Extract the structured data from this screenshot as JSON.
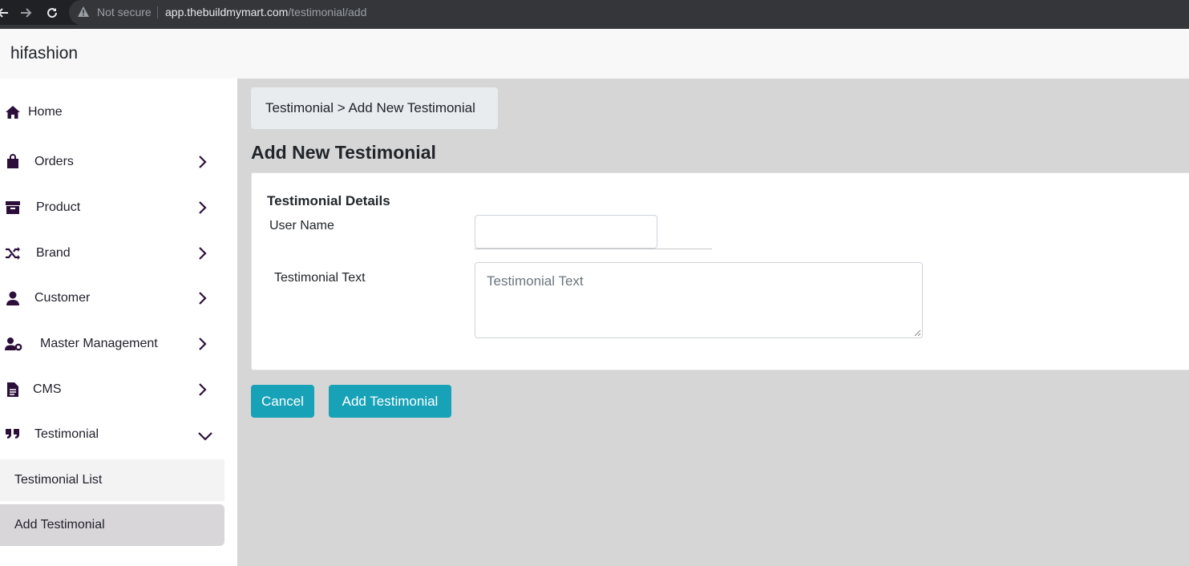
{
  "browser": {
    "security_label": "Not secure",
    "url_host": "app.thebuildmymart.com",
    "url_path": "/testimonial/add"
  },
  "header": {
    "brand": "hifashion"
  },
  "sidebar": {
    "items": [
      {
        "label": "Home",
        "icon": "home-icon",
        "has_chevron": false
      },
      {
        "label": "Orders",
        "icon": "shopping-bag-icon",
        "has_chevron": true
      },
      {
        "label": "Product",
        "icon": "archive-box-icon",
        "has_chevron": true
      },
      {
        "label": "Brand",
        "icon": "shuffle-icon",
        "has_chevron": true
      },
      {
        "label": "Customer",
        "icon": "user-icon",
        "has_chevron": true
      },
      {
        "label": "Master Management",
        "icon": "user-cog-icon",
        "has_chevron": true
      },
      {
        "label": "CMS",
        "icon": "document-icon",
        "has_chevron": true
      },
      {
        "label": "Testimonial",
        "icon": "quote-icon",
        "expanded": true
      }
    ],
    "subitems": [
      {
        "label": "Testimonial List",
        "active": false
      },
      {
        "label": "Add Testimonial",
        "active": true
      }
    ]
  },
  "main": {
    "breadcrumb": "Testimonial > Add New Testimonial",
    "title": "Add New Testimonial",
    "card_title": "Testimonial Details",
    "username_label": "User Name",
    "username_value": "",
    "text_label": "Testimonial Text",
    "text_placeholder": "Testimonial Text",
    "cancel_label": "Cancel",
    "add_label": "Add Testimonial"
  },
  "colors": {
    "accent": "#17a2b8",
    "sidebar_icon": "#2b0f3a",
    "content_bg": "#d6d6d6"
  }
}
